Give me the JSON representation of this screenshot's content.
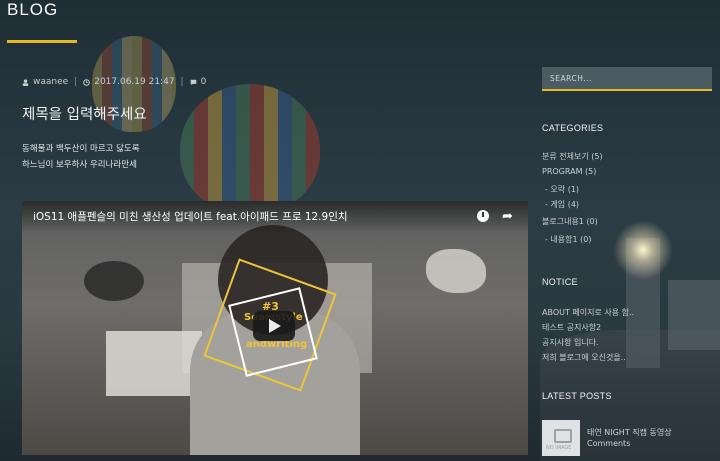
{
  "brand": {
    "name": "BLOG"
  },
  "post": {
    "author": "waanee",
    "date": "2017.06.19 21:47",
    "comments": "0",
    "title": "제목을 입력해주세요",
    "body_lines": [
      "동해물과 백두산이 마르고 닳도록",
      "하느님이 보우하사 우리나라만세"
    ]
  },
  "video": {
    "title": "iOS11 애플펜슬의 미친 생산성 업데이트 feat.아이패드 프로 12.9인치",
    "thumb_text": [
      "#3",
      "Seamstyle",
      "andwriting"
    ]
  },
  "sidebar": {
    "search_placeholder": "SEARCH...",
    "categories_title": "CATEGORIES",
    "categories": [
      {
        "label": "분류 전체보기 (5)"
      },
      {
        "label": "PROGRAM (5)"
      },
      {
        "label": "- 오락 (1)"
      },
      {
        "label": "- 게임 (4)"
      },
      {
        "label": "블로그내용1 (0)"
      },
      {
        "label": "- 내용함1 (0)"
      }
    ],
    "notice_title": "NOTICE",
    "notices": [
      "ABOUT 페이지로 사용 함..",
      "테스트 공지사항2",
      "공지사항 입니다.",
      "저희 블로그에 오신것을.."
    ],
    "latest_title": "LATEST POSTS",
    "latest_posts": [
      {
        "title": "태연 NIGHT 직캠 동영상",
        "meta": "Comments",
        "thumb_label": "NO IMAGE"
      }
    ]
  },
  "colors": {
    "accent": "#e6b923",
    "background": "#2b3c44"
  }
}
